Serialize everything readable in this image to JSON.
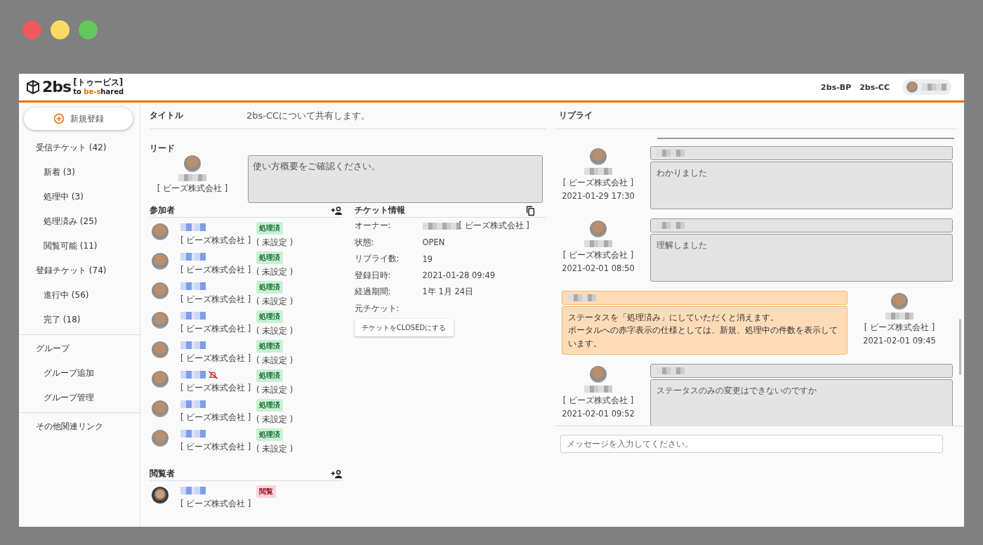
{
  "logo": {
    "mark": "2bs",
    "ruby": "[トゥービス]",
    "tagline": [
      "to ",
      "be-s",
      "hared"
    ]
  },
  "header": {
    "links": [
      "2bs-BP",
      "2bs-CC"
    ]
  },
  "sidebar": {
    "new_button": "新規登録",
    "sections": [
      [
        {
          "label": "受信チケット (42)",
          "children": [
            {
              "label": "新着 (3)"
            },
            {
              "label": "処理中 (3)"
            },
            {
              "label": "処理済み (25)"
            },
            {
              "label": "閲覧可能 (11)"
            }
          ]
        },
        {
          "label": "登録チケット (74)",
          "children": [
            {
              "label": "進行中 (56)"
            },
            {
              "label": "完了 (18)"
            }
          ]
        }
      ],
      [
        {
          "label": "グループ",
          "children": [
            {
              "label": "グループ追加"
            },
            {
              "label": "グループ管理"
            }
          ]
        }
      ],
      [
        {
          "label": "その他関連リンク"
        }
      ]
    ]
  },
  "ticket": {
    "title_label": "タイトル",
    "title": "2bs-CCについて共有します。",
    "lead_label": "リード",
    "lead_company": "[ ビーズ株式会社 ]",
    "lead_message": "使い方概要をご確認ください。"
  },
  "participants": {
    "heading": "参加者",
    "items": [
      {
        "company": "[ ビーズ株式会社 ]",
        "badge": "処理済",
        "kind": "done",
        "role": "( 未設定 )",
        "notifications_off": false
      },
      {
        "company": "[ ビーズ株式会社 ]",
        "badge": "処理済",
        "kind": "done",
        "role": "( 未設定 )",
        "notifications_off": false
      },
      {
        "company": "[ ビーズ株式会社 ]",
        "badge": "処理済",
        "kind": "done",
        "role": "( 未設定 )",
        "notifications_off": false
      },
      {
        "company": "[ ビーズ株式会社 ]",
        "badge": "処理済",
        "kind": "done",
        "role": "( 未設定 )",
        "notifications_off": false
      },
      {
        "company": "[ ビーズ株式会社 ]",
        "badge": "処理済",
        "kind": "done",
        "role": "( 未設定 )",
        "notifications_off": false
      },
      {
        "company": "[ ビーズ株式会社 ]",
        "badge": "処理済",
        "kind": "done",
        "role": "( 未設定 )",
        "notifications_off": true
      },
      {
        "company": "[ ビーズ株式会社 ]",
        "badge": "処理済",
        "kind": "done",
        "role": "( 未設定 )",
        "notifications_off": false
      },
      {
        "company": "[ ビーズ株式会社 ]",
        "badge": "処理済",
        "kind": "done",
        "role": "( 未設定 )",
        "notifications_off": false
      }
    ]
  },
  "viewers": {
    "heading": "閲覧者",
    "items": [
      {
        "company": "[ ビーズ株式会社 ]",
        "badge": "閲覧",
        "kind": "view"
      }
    ]
  },
  "ticket_info": {
    "heading": "チケット情報",
    "fields": [
      {
        "kind": "person",
        "label": "オーナー:",
        "value": "[ ビーズ株式会社 ]"
      },
      {
        "kind": "text",
        "label": "状態:",
        "value": "OPEN"
      },
      {
        "kind": "text",
        "label": "リプライ数:",
        "value": "19"
      },
      {
        "kind": "text",
        "label": "登録日時:",
        "value": "2021-01-28 09:49"
      },
      {
        "kind": "text",
        "label": "経過期間:",
        "value": "1年 1月 24日"
      },
      {
        "kind": "text",
        "label": "元チケット:"
      }
    ],
    "close_button": "チケットをCLOSEDにする"
  },
  "replies": {
    "heading": "リプライ",
    "items": [
      {
        "kind": "other",
        "company": "[ ビーズ株式会社 ]",
        "time": "2021-01-29 17:30",
        "message": "わかりました"
      },
      {
        "kind": "other",
        "company": "[ ビーズ株式会社 ]",
        "time": "2021-02-01 08:50",
        "message": "理解しました"
      },
      {
        "kind": "self",
        "company": "[ ビーズ株式会社 ]",
        "time": "2021-02-01 09:45",
        "message": "ステータスを「処理済み」にしていただくと消えます。",
        "message_2": "ポータルへの赤字表示の仕様としては、新規、処理中の件数を表示しています。"
      },
      {
        "kind": "other",
        "company": "[ ビーズ株式会社 ]",
        "time": "2021-02-01 09:52",
        "message": "ステータスのみの変更はできないのですか"
      }
    ],
    "input_placeholder": "メッセージを入力してください。"
  }
}
